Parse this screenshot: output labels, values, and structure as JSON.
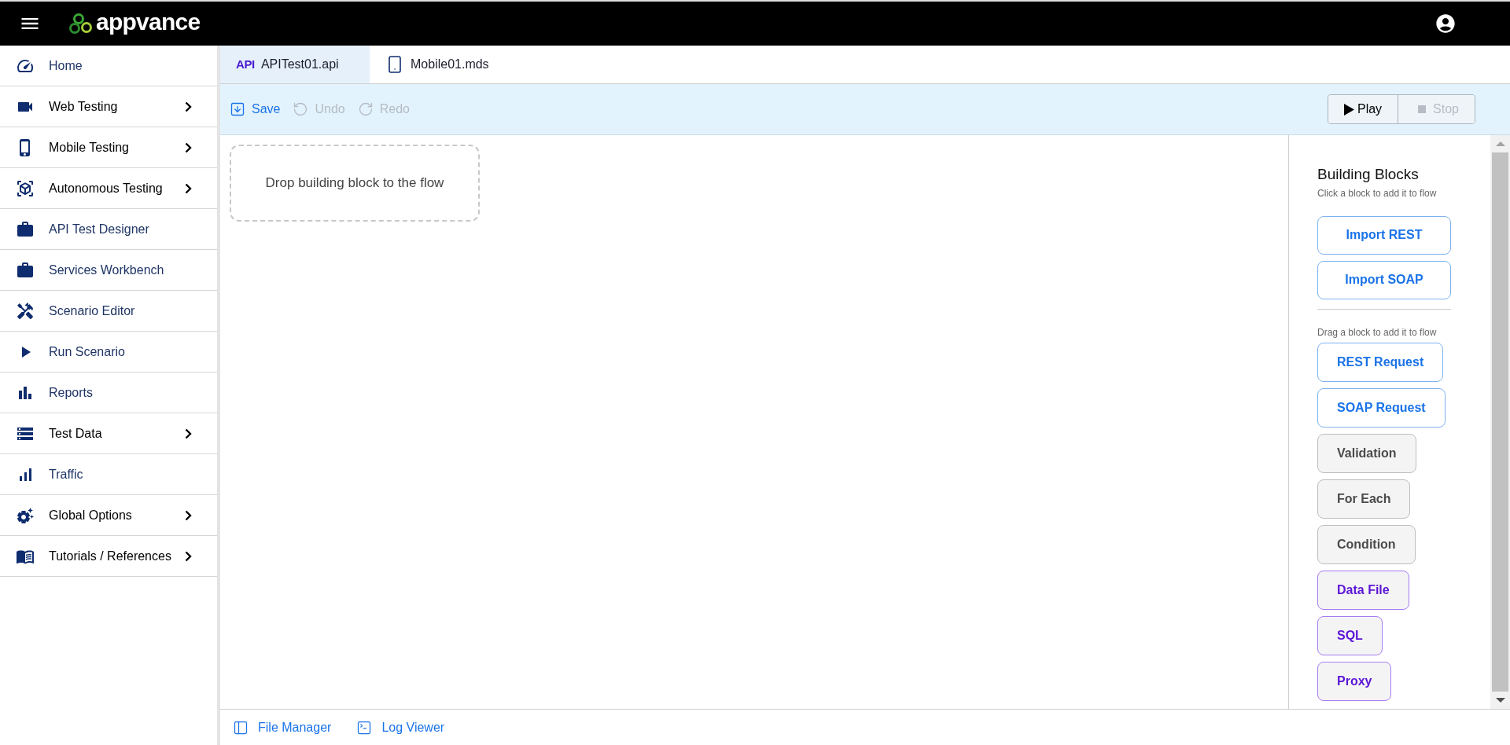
{
  "header": {
    "logo_text": "appvance"
  },
  "sidebar": {
    "items": [
      {
        "label": "Home",
        "expandable": false
      },
      {
        "label": "Web Testing",
        "expandable": true
      },
      {
        "label": "Mobile Testing",
        "expandable": true
      },
      {
        "label": "Autonomous Testing",
        "expandable": true
      },
      {
        "label": "API Test Designer",
        "expandable": false
      },
      {
        "label": "Services Workbench",
        "expandable": false
      },
      {
        "label": "Scenario Editor",
        "expandable": false
      },
      {
        "label": "Run Scenario",
        "expandable": false
      },
      {
        "label": "Reports",
        "expandable": false
      },
      {
        "label": "Test Data",
        "expandable": true
      },
      {
        "label": "Traffic",
        "expandable": false
      },
      {
        "label": "Global Options",
        "expandable": true
      },
      {
        "label": "Tutorials / References",
        "expandable": true
      }
    ]
  },
  "tabs": [
    {
      "kind": "api",
      "badge": "API",
      "label": "APITest01.api",
      "selected": true
    },
    {
      "kind": "mobile",
      "label": "Mobile01.mds",
      "selected": false
    }
  ],
  "toolbar": {
    "actions": [
      {
        "kind": "save",
        "label": "Save",
        "disabled": false
      },
      {
        "kind": "undo",
        "label": "Undo",
        "disabled": true
      },
      {
        "kind": "redo",
        "label": "Redo",
        "disabled": true
      }
    ],
    "run": [
      {
        "kind": "play",
        "label": "Play",
        "disabled": false
      },
      {
        "kind": "stop",
        "label": "Stop",
        "disabled": true
      }
    ]
  },
  "canvas": {
    "drop_hint": "Drop building block to the flow"
  },
  "building_blocks": {
    "title": "Building Blocks",
    "click_hint": "Click a block to add it to flow",
    "click_blocks": [
      {
        "label": "Import REST",
        "kind": "request"
      },
      {
        "label": "Import SOAP",
        "kind": "request"
      }
    ],
    "drag_hint": "Drag a block to add it to flow",
    "drag_blocks": [
      {
        "label": "REST Request",
        "kind": "request"
      },
      {
        "label": "SOAP Request",
        "kind": "request"
      },
      {
        "label": "Validation",
        "kind": "logic"
      },
      {
        "label": "For Each",
        "kind": "logic"
      },
      {
        "label": "Condition",
        "kind": "logic"
      },
      {
        "label": "Data File",
        "kind": "data"
      },
      {
        "label": "SQL",
        "kind": "data"
      },
      {
        "label": "Proxy",
        "kind": "data"
      }
    ]
  },
  "bottom_bar": [
    {
      "kind": "files",
      "label": "File Manager"
    },
    {
      "kind": "log",
      "label": "Log Viewer"
    }
  ]
}
